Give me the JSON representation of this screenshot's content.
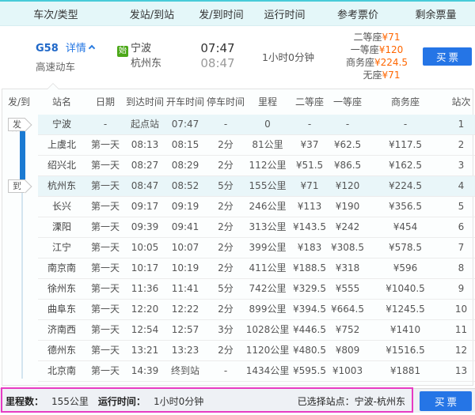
{
  "colors": {
    "header_teal": "#47cbd9",
    "header_bg": "#e4f7f9",
    "link_blue": "#2577e3",
    "price_orange": "#ff6600",
    "button_blue": "#2575e6",
    "origin_badge_green": "#4ca818",
    "highlight_row": "#e9f6f9",
    "timeline_blue": "#1b7ad2",
    "annotation_pink": "#e73bc3"
  },
  "list_header": {
    "columns": [
      "车次/类型",
      "发站/到站",
      "发/到时间",
      "运行时间",
      "参考票价",
      "剩余票量"
    ]
  },
  "train": {
    "code": "G58",
    "details_label": "详情",
    "type": "高速动车",
    "start_badge": "始",
    "from": "宁波",
    "to": "杭州东",
    "depart_time": "07:47",
    "arrive_time": "08:47",
    "duration": "1小时0分钟",
    "prices": [
      {
        "label": "二等座",
        "value": "¥71"
      },
      {
        "label": "一等座",
        "value": "¥120"
      },
      {
        "label": "商务座",
        "value": "¥224.5"
      },
      {
        "label": "无座",
        "value": "¥71"
      }
    ],
    "buy_button": "买票"
  },
  "stops_table": {
    "headers": [
      "发/到站",
      "站名",
      "日期",
      "到达时间",
      "开车时间",
      "停车时间",
      "里程",
      "二等座",
      "一等座",
      "商务座",
      "站次"
    ],
    "rows": [
      {
        "badge": "发",
        "station": "宁波",
        "date": "-",
        "arrive": "起点站",
        "depart": "07:47",
        "stop": "-",
        "distance": "0",
        "second": "-",
        "first": "-",
        "business": "-",
        "seq": "1",
        "highlight": true
      },
      {
        "station": "上虞北",
        "date": "第一天",
        "arrive": "08:13",
        "depart": "08:15",
        "stop": "2分",
        "distance": "81公里",
        "second": "¥37",
        "first": "¥62.5",
        "business": "¥117.5",
        "seq": "2"
      },
      {
        "station": "绍兴北",
        "date": "第一天",
        "arrive": "08:27",
        "depart": "08:29",
        "stop": "2分",
        "distance": "112公里",
        "second": "¥51.5",
        "first": "¥86.5",
        "business": "¥162.5",
        "seq": "3"
      },
      {
        "badge": "到",
        "station": "杭州东",
        "date": "第一天",
        "arrive": "08:47",
        "depart": "08:52",
        "stop": "5分",
        "distance": "155公里",
        "second": "¥71",
        "first": "¥120",
        "business": "¥224.5",
        "seq": "4",
        "highlight": true
      },
      {
        "station": "长兴",
        "date": "第一天",
        "arrive": "09:17",
        "depart": "09:19",
        "stop": "2分",
        "distance": "246公里",
        "second": "¥113",
        "first": "¥190",
        "business": "¥356.5",
        "seq": "5"
      },
      {
        "station": "溧阳",
        "date": "第一天",
        "arrive": "09:39",
        "depart": "09:41",
        "stop": "2分",
        "distance": "313公里",
        "second": "¥143.5",
        "first": "¥242",
        "business": "¥454",
        "seq": "6"
      },
      {
        "station": "江宁",
        "date": "第一天",
        "arrive": "10:05",
        "depart": "10:07",
        "stop": "2分",
        "distance": "399公里",
        "second": "¥183",
        "first": "¥308.5",
        "business": "¥578.5",
        "seq": "7"
      },
      {
        "station": "南京南",
        "date": "第一天",
        "arrive": "10:17",
        "depart": "10:19",
        "stop": "2分",
        "distance": "411公里",
        "second": "¥188.5",
        "first": "¥318",
        "business": "¥596",
        "seq": "8"
      },
      {
        "station": "徐州东",
        "date": "第一天",
        "arrive": "11:36",
        "depart": "11:41",
        "stop": "5分",
        "distance": "742公里",
        "second": "¥329.5",
        "first": "¥555",
        "business": "¥1040.5",
        "seq": "9"
      },
      {
        "station": "曲阜东",
        "date": "第一天",
        "arrive": "12:20",
        "depart": "12:22",
        "stop": "2分",
        "distance": "899公里",
        "second": "¥394.5",
        "first": "¥664.5",
        "business": "¥1245.5",
        "seq": "10"
      },
      {
        "station": "济南西",
        "date": "第一天",
        "arrive": "12:54",
        "depart": "12:57",
        "stop": "3分",
        "distance": "1028公里",
        "second": "¥446.5",
        "first": "¥752",
        "business": "¥1410",
        "seq": "11"
      },
      {
        "station": "德州东",
        "date": "第一天",
        "arrive": "13:21",
        "depart": "13:23",
        "stop": "2分",
        "distance": "1120公里",
        "second": "¥480.5",
        "first": "¥809",
        "business": "¥1516.5",
        "seq": "12"
      },
      {
        "station": "北京南",
        "date": "第一天",
        "arrive": "14:39",
        "depart": "终到站",
        "stop": "-",
        "distance": "1434公里",
        "second": "¥595.5",
        "first": "¥1003",
        "business": "¥1881",
        "seq": "13"
      }
    ]
  },
  "footer": {
    "distance_label": "里程数：",
    "distance_value": "155公里",
    "duration_label": "运行时间：",
    "duration_value": "1小时0分钟",
    "selected_label": "已选择站点：宁波-杭州东",
    "buy_button": "买票"
  }
}
